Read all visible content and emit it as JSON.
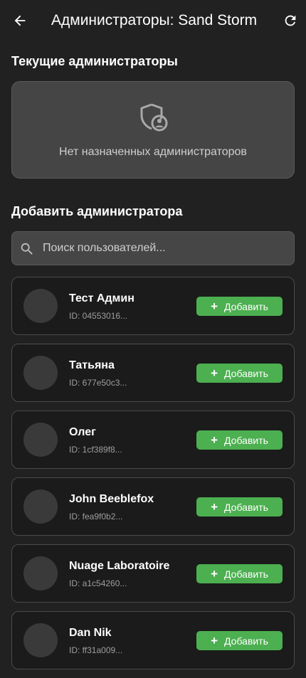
{
  "header": {
    "title": "Администраторы: Sand Storm",
    "back_icon": "arrow-back-icon",
    "refresh_icon": "refresh-icon"
  },
  "current_admins": {
    "title": "Текущие администраторы",
    "empty_icon": "admin-shield-icon",
    "empty_message": "Нет назначенных администраторов"
  },
  "add_admin": {
    "title": "Добавить администратора",
    "search_placeholder": "Поиск пользователей...",
    "search_value": "",
    "add_label": "Добавить",
    "users": [
      {
        "name": "Тест Админ",
        "id": "ID: 04553016..."
      },
      {
        "name": "Татьяна",
        "id": "ID: 677e50c3..."
      },
      {
        "name": "Олег",
        "id": "ID: 1cf389f8..."
      },
      {
        "name": "John Beeblefox",
        "id": "ID: fea9f0b2..."
      },
      {
        "name": "Nuage Laboratoire",
        "id": "ID: a1c54260..."
      },
      {
        "name": "Dan Nik",
        "id": "ID: ff31a009..."
      }
    ]
  },
  "colors": {
    "background": "#212121",
    "accent_green": "#4caf50",
    "card_empty": "#454545"
  }
}
